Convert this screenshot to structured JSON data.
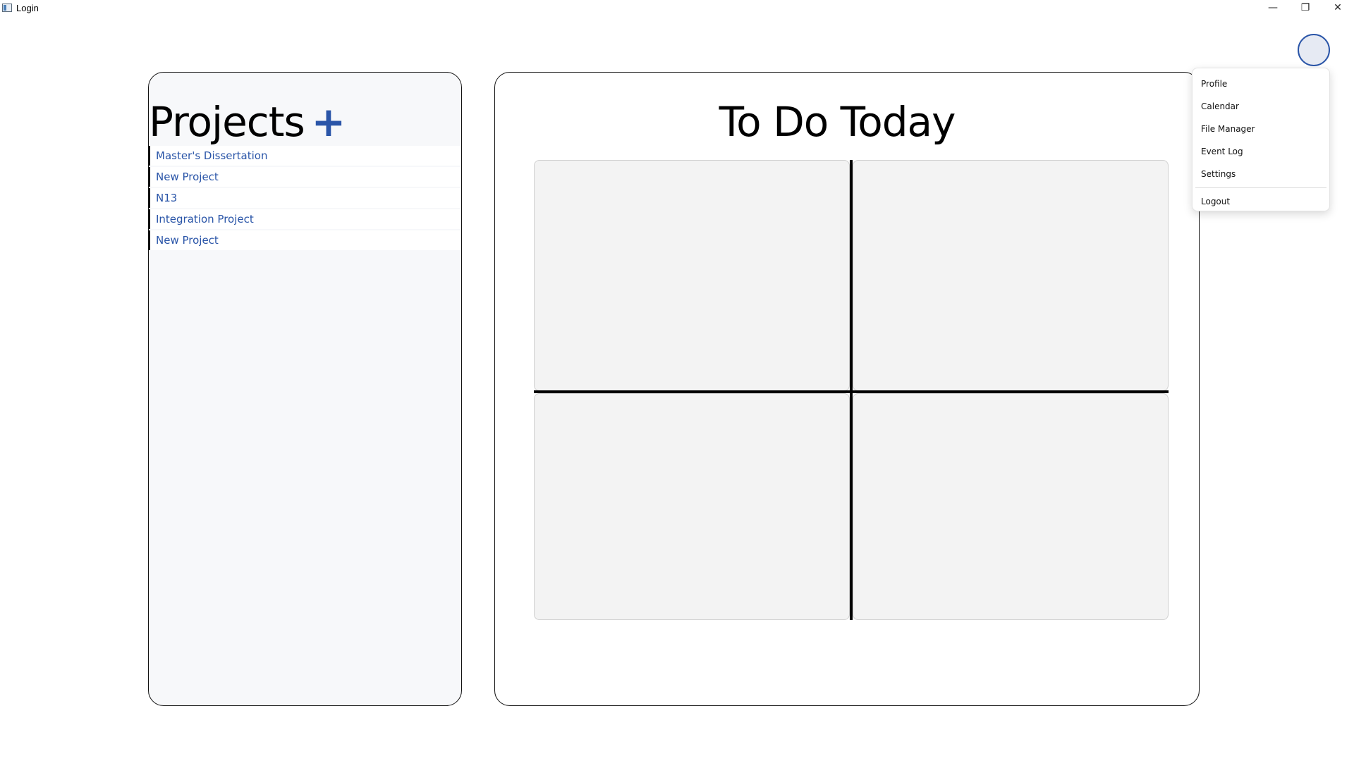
{
  "window": {
    "title": "Login",
    "controls": {
      "minimize": "—",
      "maximize": "❐",
      "close": "✕"
    }
  },
  "projects": {
    "title": "Projects",
    "add_label": "+",
    "items": [
      {
        "label": "Master's Dissertation"
      },
      {
        "label": "New Project"
      },
      {
        "label": "N13"
      },
      {
        "label": "Integration Project"
      },
      {
        "label": "New Project"
      }
    ]
  },
  "todo": {
    "title": "To Do Today"
  },
  "user_menu": {
    "items": [
      {
        "label": "Profile"
      },
      {
        "label": "Calendar"
      },
      {
        "label": "File Manager"
      },
      {
        "label": "Event Log"
      },
      {
        "label": "Settings"
      }
    ],
    "logout_label": "Logout"
  },
  "colors": {
    "accent": "#2a55a8",
    "panel_bg": "#f7f8fa",
    "quadrant_bg": "#f3f3f3"
  }
}
